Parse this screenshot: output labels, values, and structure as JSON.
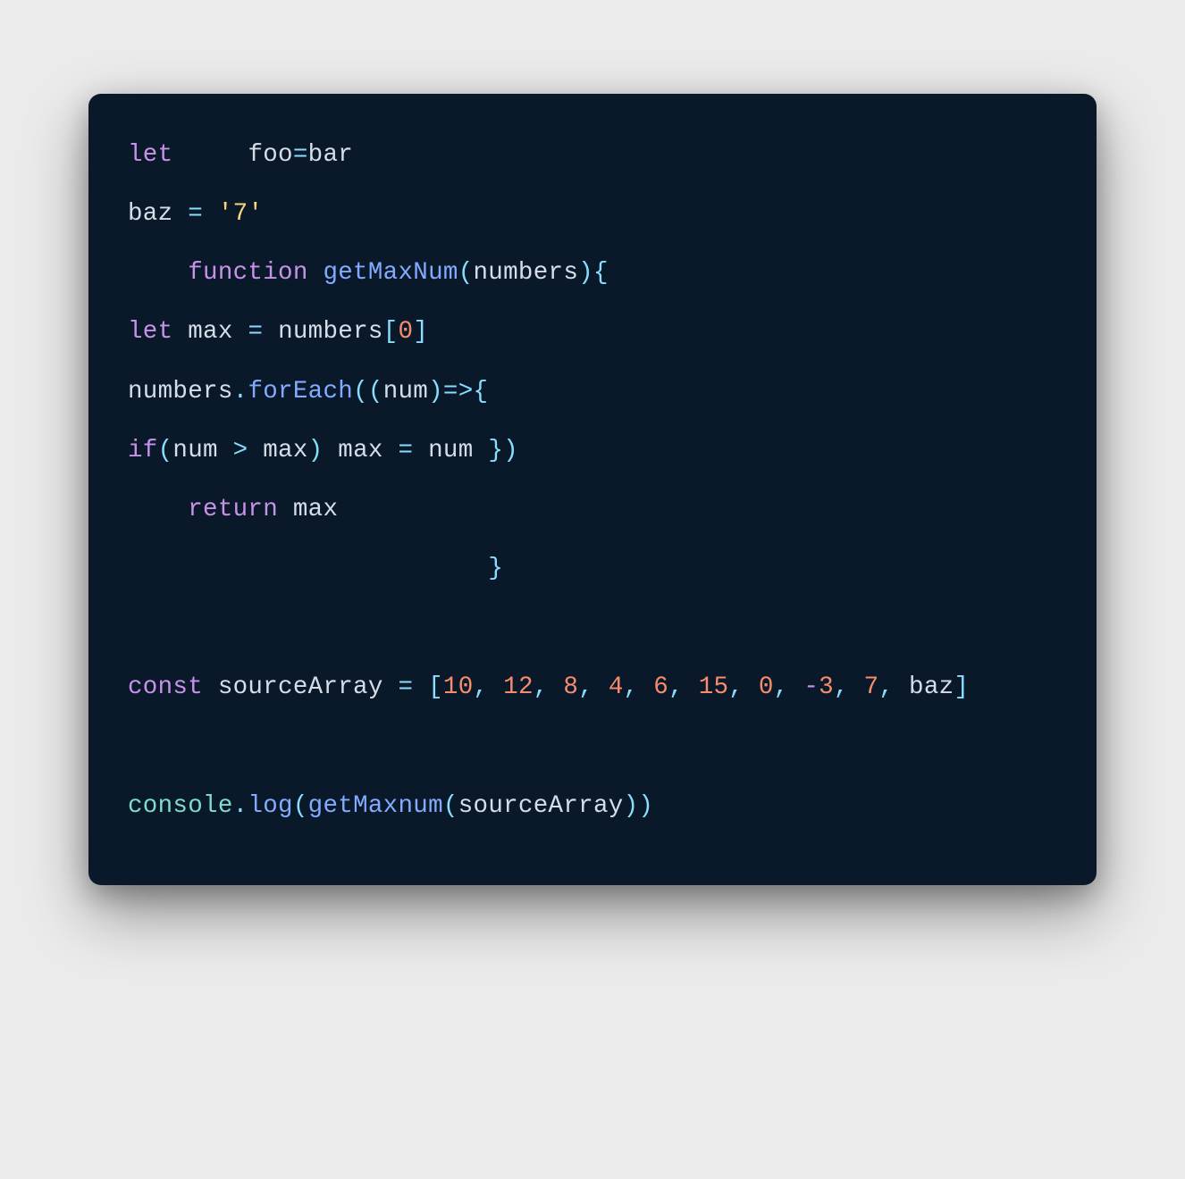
{
  "colors": {
    "background": "#ebebeb",
    "card": "#0a1929",
    "keyword": "#c792ea",
    "default": "#d5dde8",
    "string": "#f9d67b",
    "function": "#82aaff",
    "number": "#f78c6c",
    "method_dot": "#89ddff",
    "punct": "#89ddff",
    "console": "#7fdbca"
  },
  "code": {
    "line1": {
      "kw_let": "let",
      "spaces": "     ",
      "ident_foo": "foo",
      "eq": "=",
      "ident_bar": "bar"
    },
    "line2": {
      "ident_baz": "baz ",
      "eq": "=",
      "sp": " ",
      "str": "'7'"
    },
    "line3": {
      "indent": "    ",
      "kw_function": "function",
      "sp": " ",
      "fname": "getMaxNum",
      "lparen": "(",
      "param": "numbers",
      "rparen": ")",
      "lbrace": "{"
    },
    "line4": {
      "kw_let": "let",
      "sp1": " ",
      "ident_max": "max ",
      "eq": "=",
      "sp2": " ",
      "ident_numbers": "numbers",
      "lbracket": "[",
      "zero": "0",
      "rbracket": "]"
    },
    "line5": {
      "ident_numbers": "numbers",
      "dot": ".",
      "method": "forEach",
      "lparen1": "(",
      "lparen2": "(",
      "param": "num",
      "rparen1": ")",
      "arrow": "=>",
      "lbrace": "{"
    },
    "line6": {
      "kw_if": "if",
      "lparen": "(",
      "ident_num": "num ",
      "gt": ">",
      "ident_max1": " max",
      "rparen": ")",
      "ident_max2": " max ",
      "eq": "=",
      "ident_num2": " num ",
      "rbrace": "}",
      "rparen2": ")"
    },
    "line7": {
      "indent": "    ",
      "kw_return": "return",
      "sp": " ",
      "ident_max": "max"
    },
    "line8": {
      "indent": "                        ",
      "rbrace": "}"
    },
    "line9": {
      "kw_const": "const",
      "sp": " ",
      "ident": "sourceArray ",
      "eq": "=",
      "sp2": " ",
      "lbracket": "[",
      "n1": "10",
      "c1": ",",
      "s1": " ",
      "n2": "12",
      "c2": ",",
      "s2": " ",
      "n3": "8",
      "c3": ",",
      "s3": " ",
      "n4": "4",
      "c4": ",",
      "s4": " ",
      "n5": "6",
      "c5": ",",
      "s5": " ",
      "n6": "15",
      "c6": ",",
      "s6": " ",
      "n7": "0",
      "c7": ",",
      "s7": " ",
      "minus": "-",
      "n8": "3",
      "c8": ",",
      "s8": " ",
      "n9": "7",
      "c9": ",",
      "s9": " ",
      "ident_baz": "baz",
      "rbracket": "]"
    },
    "line10": {
      "console": "console",
      "dot": ".",
      "log": "log",
      "lparen": "(",
      "fn": "getMaxnum",
      "lparen2": "(",
      "arg": "sourceArray",
      "rparen2": ")",
      "rparen": ")"
    }
  }
}
